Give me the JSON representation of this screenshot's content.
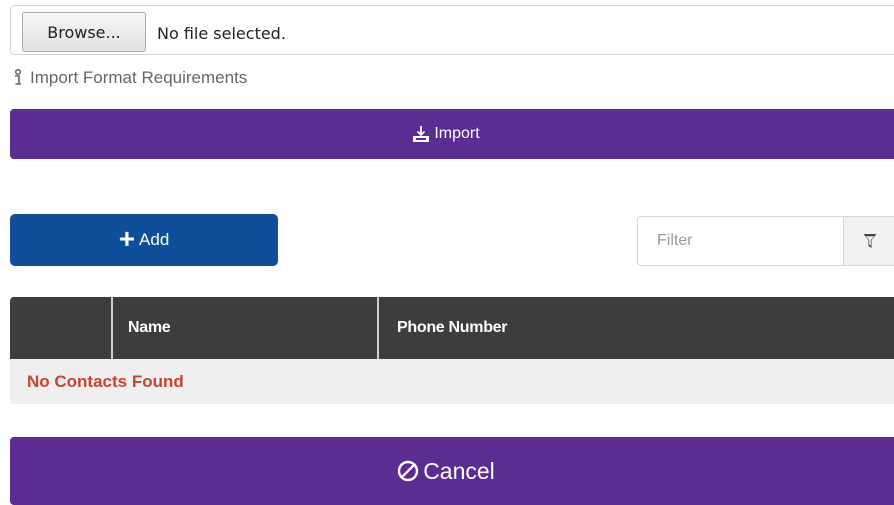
{
  "file_input": {
    "browse_label": "Browse...",
    "status_text": "No file selected."
  },
  "info_link": {
    "icon": "info-icon",
    "label": "Import Format Requirements"
  },
  "import_button": {
    "icon": "upload-tray-icon",
    "label": "Import"
  },
  "add_button": {
    "icon": "plus-icon",
    "label": "Add"
  },
  "filter": {
    "placeholder": "Filter",
    "value": "",
    "icon": "funnel-icon"
  },
  "table": {
    "columns": [
      "",
      "Name",
      "Phone Number"
    ],
    "empty_message": "No Contacts Found"
  },
  "cancel_button": {
    "icon": "circle-slash-icon",
    "label": "Cancel"
  },
  "colors": {
    "primary_purple": "#5b2c91",
    "primary_blue": "#0f4f9a",
    "table_header": "#3d3d3d",
    "empty_text": "#c9442f"
  }
}
